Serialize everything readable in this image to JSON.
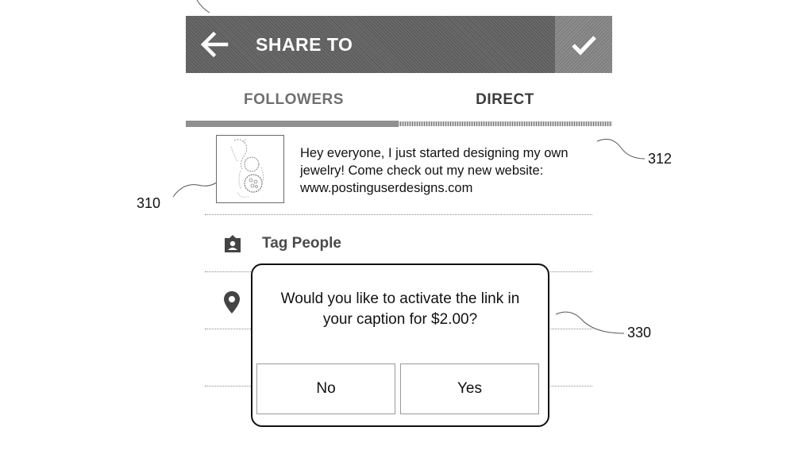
{
  "header": {
    "title": "SHARE TO",
    "back_icon": "arrow-left-icon",
    "confirm_icon": "checkmark-icon"
  },
  "tabs": [
    {
      "label": "FOLLOWERS",
      "active": true
    },
    {
      "label": "DIRECT",
      "active": false
    }
  ],
  "post": {
    "caption_lines": [
      "Hey everyone, I just started designing my own",
      "jewelry!  Come check out my new website:",
      "www.postinguserdesigns.com"
    ]
  },
  "options": {
    "tag_people_label": "Tag People",
    "tag_icon": "person-tag-icon",
    "location_icon": "location-pin-icon"
  },
  "dialog": {
    "message_lines": [
      "Would you like to activate the link in",
      "your caption for $2.00?"
    ],
    "no_label": "No",
    "yes_label": "Yes"
  },
  "reference_numerals": {
    "thumbnail": "310",
    "caption": "312",
    "dialog": "330"
  }
}
